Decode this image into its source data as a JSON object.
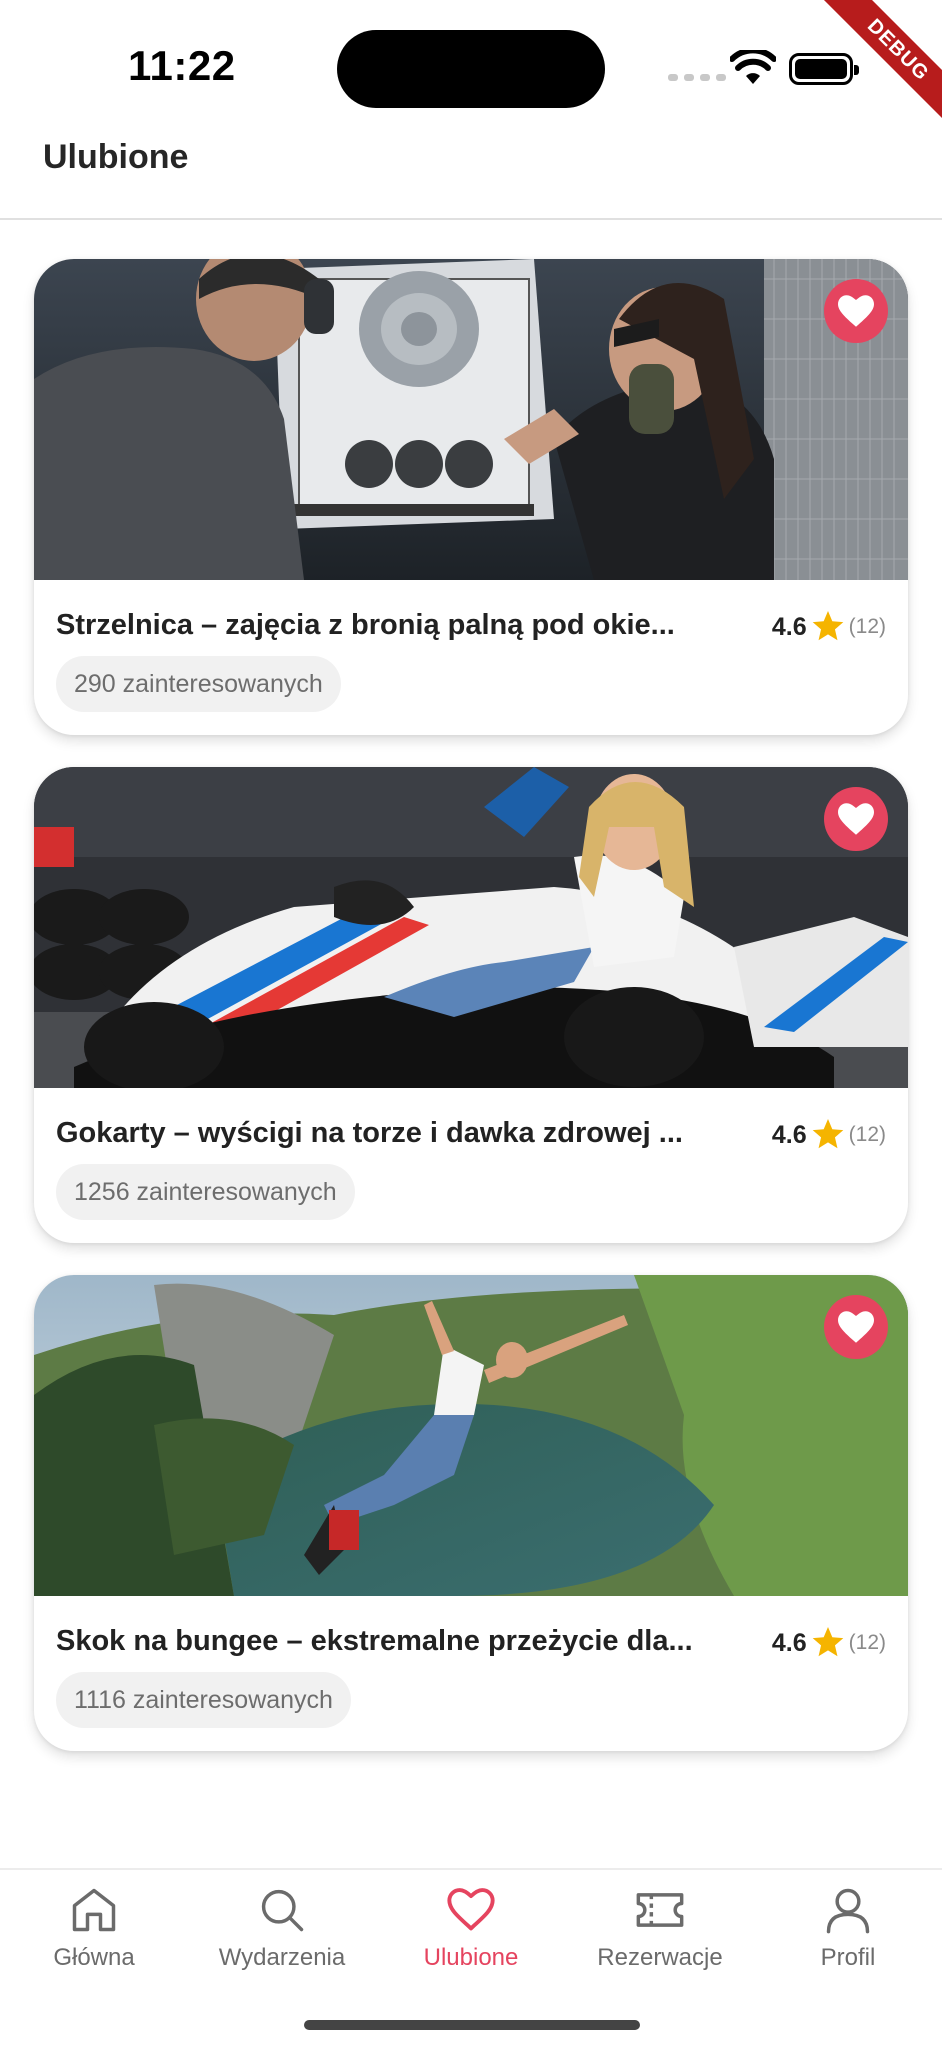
{
  "status_bar": {
    "time": "11:22",
    "debug_label": "DEBUG"
  },
  "header": {
    "title": "Ulubione"
  },
  "cards": [
    {
      "title": "Strzelnica – zajęcia z bronią palną pod okie...",
      "rating": "4.6",
      "reviews": "(12)",
      "interested": "290 zainteresowanych",
      "image_icon": "shooting-range-photo",
      "favorited": true
    },
    {
      "title": "Gokarty – wyścigi na torze i dawka zdrowej ...",
      "rating": "4.6",
      "reviews": "(12)",
      "interested": "1256 zainteresowanych",
      "image_icon": "go-kart-photo",
      "favorited": true
    },
    {
      "title": "Skok na bungee – ekstremalne przeżycie dla...",
      "rating": "4.6",
      "reviews": "(12)",
      "interested": "1116 zainteresowanych",
      "image_icon": "bungee-jump-photo",
      "favorited": true
    }
  ],
  "nav": {
    "items": [
      {
        "label": "Główna",
        "icon": "home-icon"
      },
      {
        "label": "Wydarzenia",
        "icon": "search-icon"
      },
      {
        "label": "Ulubione",
        "icon": "heart-icon",
        "active": true
      },
      {
        "label": "Rezerwacje",
        "icon": "ticket-icon"
      },
      {
        "label": "Profil",
        "icon": "user-icon"
      }
    ]
  },
  "colors": {
    "accent": "#e5445f",
    "star": "#f5b400"
  }
}
